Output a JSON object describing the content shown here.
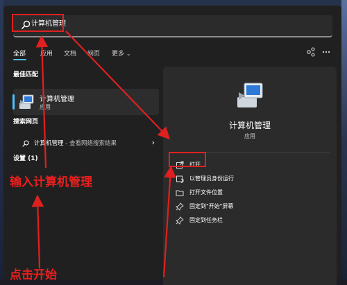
{
  "search": {
    "value": "计算机管理"
  },
  "tabs": [
    {
      "label": "全部",
      "active": true
    },
    {
      "label": "应用"
    },
    {
      "label": "文档"
    },
    {
      "label": "网页"
    },
    {
      "label": "更多"
    }
  ],
  "tab_more_chevron": "⌄",
  "left": {
    "best_match_header": "最佳匹配",
    "best_match": {
      "title": "计算机管理",
      "subtitle": "应用"
    },
    "search_web_header": "搜索网页",
    "web_result": {
      "title": "计算机管理",
      "suffix": " - 查看网络搜索结果"
    },
    "settings_header": "设置 (1)"
  },
  "right": {
    "title": "计算机管理",
    "subtitle": "应用",
    "actions": [
      {
        "label": "打开",
        "icon": "open-external-icon"
      },
      {
        "label": "以管理员身份运行",
        "icon": "admin-shield-icon"
      },
      {
        "label": "打开文件位置",
        "icon": "folder-icon"
      },
      {
        "label": "固定到\"开始\"屏幕",
        "icon": "pin-icon"
      },
      {
        "label": "固定到任务栏",
        "icon": "pin-icon"
      }
    ]
  },
  "annotations": {
    "input_hint": "输入计算机管理",
    "click_hint": "点击开始"
  },
  "colors": {
    "accent": "#4cc2ff",
    "annotation": "#e02020",
    "panel": "#202020",
    "pane": "#2b2b2b"
  }
}
